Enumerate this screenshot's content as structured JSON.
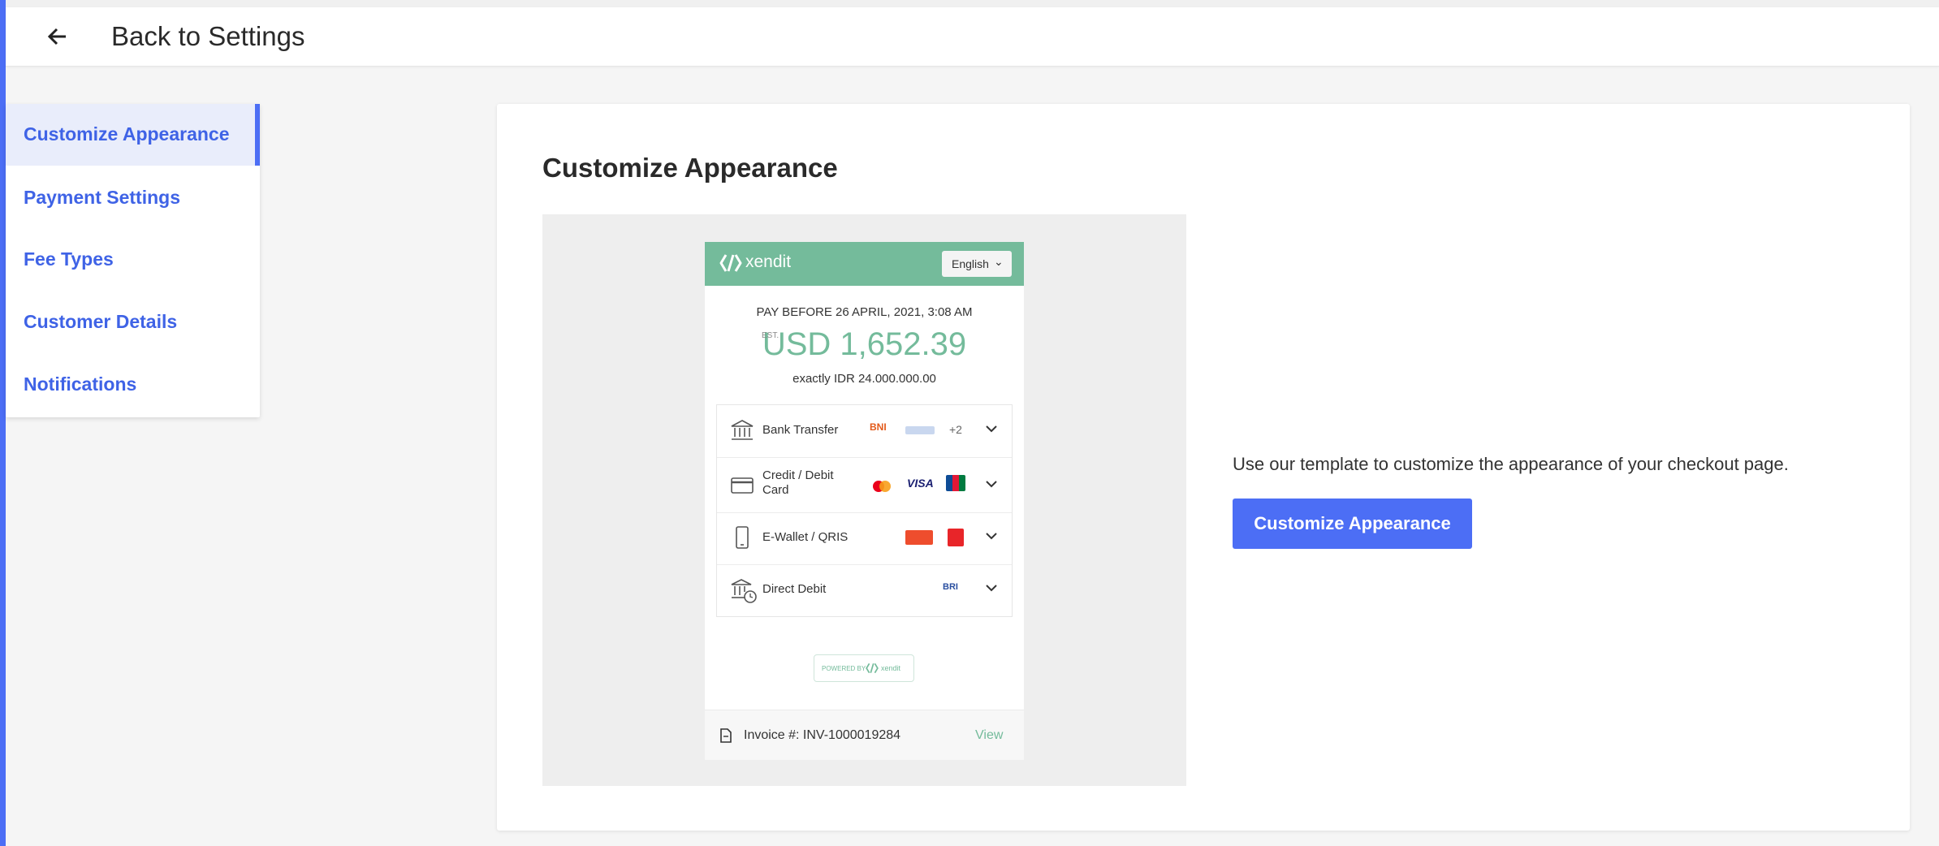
{
  "header": {
    "back_icon": "arrow-left-icon",
    "back_label": "Back to Settings"
  },
  "sidebar": {
    "items": [
      {
        "label": "Customize Appearance",
        "active": true
      },
      {
        "label": "Payment Settings"
      },
      {
        "label": "Fee Types"
      },
      {
        "label": "Customer Details"
      },
      {
        "label": "Notifications"
      }
    ]
  },
  "main": {
    "title": "Customize Appearance",
    "description": "Use our template to customize the appearance of your checkout page.",
    "cta_label": "Customize Appearance",
    "accent_color": "#4c6ef5"
  },
  "preview": {
    "brand": "xendit",
    "brand_color": "#74bb9b",
    "language": "English",
    "pay_before": "PAY BEFORE 26 APRIL, 2021, 3:08 AM",
    "est_label": "EST.",
    "amount": "USD 1,652.39",
    "exact": "exactly IDR 24.000.000.00",
    "methods": [
      {
        "label": "Bank Transfer",
        "icon": "bank-icon",
        "extra": "+2",
        "logos": [
          "BNI",
          "bank-logo"
        ]
      },
      {
        "label": "Credit / Debit Card",
        "icon": "card-icon",
        "logos": [
          "mastercard",
          "VISA",
          "JCB"
        ]
      },
      {
        "label": "E-Wallet / QRIS",
        "icon": "phone-icon",
        "logos": [
          "ShopeePay",
          "LinkAja"
        ]
      },
      {
        "label": "Direct Debit",
        "icon": "bank-clock-icon",
        "logos": [
          "BRI"
        ]
      }
    ],
    "powered_by": "POWERED BY",
    "powered_brand": "xendit",
    "invoice_label": "Invoice #: INV-1000019284",
    "view_label": "View"
  }
}
